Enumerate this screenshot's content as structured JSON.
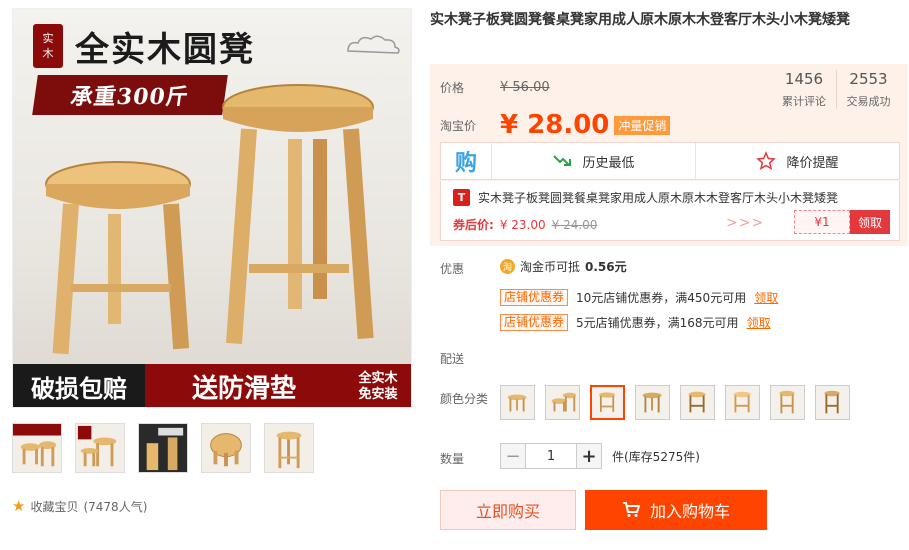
{
  "gallery": {
    "banner_title": "全实木圆凳",
    "seal_text": [
      "实",
      "木"
    ],
    "weight_text": "承重300斤",
    "bottom_left": "破损包赔",
    "bottom_mid": "送防滑垫",
    "bottom_right": [
      "全实木",
      "免安装"
    ],
    "thumb_count": 5,
    "favorite_label": "收藏宝贝",
    "favorite_count": "(7478人气)"
  },
  "product": {
    "title": "实木凳子板凳圆凳餐桌凳家用成人原木原木木登客厅木头小木凳矮凳"
  },
  "price": {
    "label": "价格",
    "original": "¥ 56.00",
    "taobao_label": "淘宝价",
    "current": "¥ 28.00",
    "promo_tag": "冲量促销"
  },
  "stats": [
    {
      "num": "1456",
      "text": "累计评论"
    },
    {
      "num": "2553",
      "text": "交易成功"
    }
  ],
  "tools": {
    "gou_icon": "购",
    "history": "历史最低",
    "alert": "降价提醒"
  },
  "coupon": {
    "badge": "T",
    "title": "实木凳子板凳圆凳餐桌凳家用成人原木原木木登客厅木头小木凳矮凳",
    "after_label": "券后价:",
    "after_price": "¥ 23.00",
    "before_price": "¥ 24.00",
    "arrows": ">>>",
    "value": "¥1",
    "get_label": "领取"
  },
  "promo": {
    "label": "优惠",
    "coin_icon": "淘",
    "coin_text_pre": "淘金币可抵",
    "coin_value": "0.56元",
    "shop_coupons": [
      {
        "tag": "店铺优惠券",
        "text": "10元店铺优惠券，满450元可用",
        "get": "领取"
      },
      {
        "tag": "店铺优惠券",
        "text": "5元店铺优惠券，满168元可用",
        "get": "领取"
      }
    ]
  },
  "delivery": {
    "label": "配送"
  },
  "color": {
    "label": "颜色分类",
    "count": 8,
    "selected_index": 2
  },
  "quantity": {
    "label": "数量",
    "minus": "−",
    "value": "1",
    "plus": "+",
    "stock": "件(库存5275件)"
  },
  "actions": {
    "buy_now": "立即购买",
    "add_cart": "加入购物车"
  },
  "colors_theme": {
    "accent": "#ff4400",
    "price_bg": "#fdf1ea"
  }
}
